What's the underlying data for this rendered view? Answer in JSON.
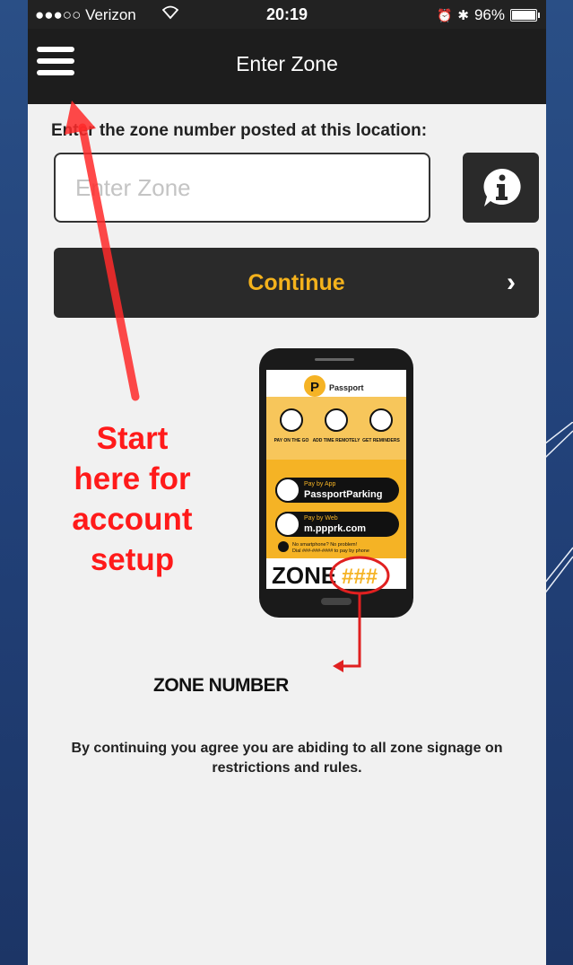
{
  "status_bar": {
    "carrier": "●●●○○ Verizon",
    "time": "20:19",
    "battery": "96%"
  },
  "nav": {
    "title": "Enter Zone"
  },
  "form": {
    "prompt": "Enter the zone number posted at this location:",
    "zone_placeholder": "Enter Zone",
    "zone_value": "",
    "continue_label": "Continue"
  },
  "illustration": {
    "brand": "Passport",
    "features": [
      "PAY ON THE GO",
      "ADD TIME REMOTELY",
      "GET REMINDERS"
    ],
    "pay_app_caption": "Pay by App",
    "pay_app_text": "PassportParking",
    "pay_web_caption": "Pay by Web",
    "pay_web_text": "m.ppprk.com",
    "help_line1": "No smartphone? No problem!",
    "help_line2": "Dial ###-###-#### to pay by phone",
    "zone_word": "ZONE",
    "zone_code": "###",
    "zone_number_label": "ZONE NUMBER"
  },
  "disclaimer": "By continuing you agree you are abiding to all zone signage on restrictions and rules.",
  "annotation": {
    "line1": "Start",
    "line2": "here for",
    "line3": "account",
    "line4": "setup"
  },
  "colors": {
    "accent": "#f4b21c",
    "annotation": "#ff1a1a",
    "navbar": "#1d1d1d",
    "slide_bg": "#22427a"
  }
}
